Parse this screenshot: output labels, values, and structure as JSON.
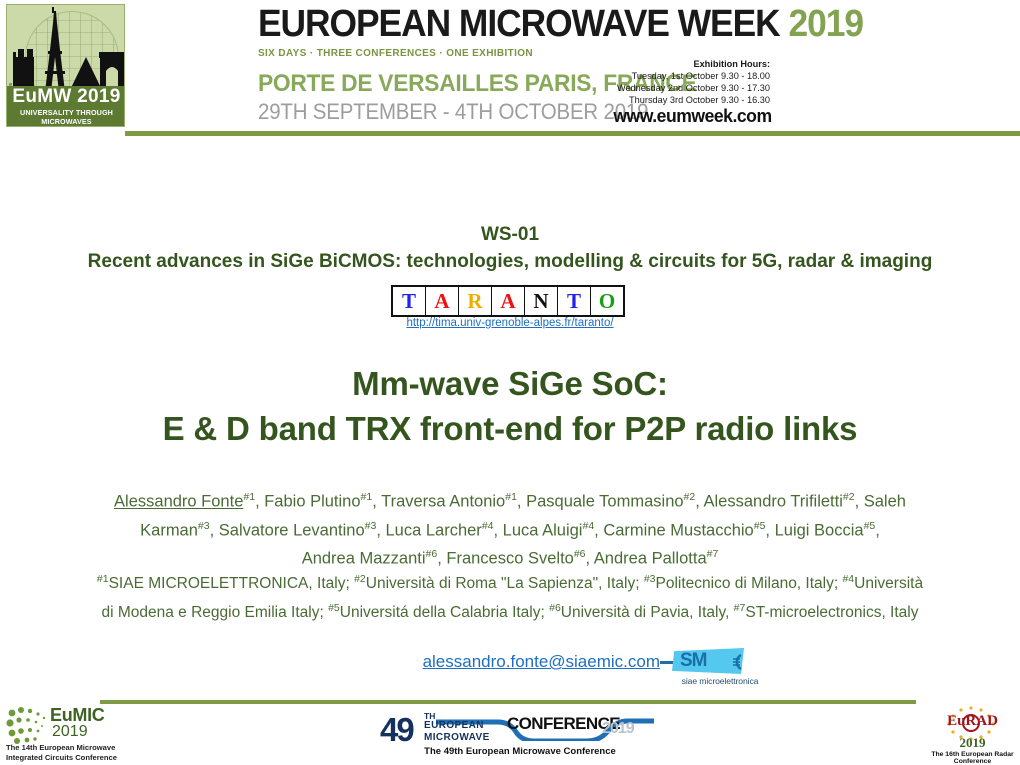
{
  "header": {
    "eumw_logo": {
      "title": "EuMW 2019",
      "tagline": "UNIVERSALITY THROUGH MICROWAVES"
    },
    "banner_title_main": "EUROPEAN MICROWAVE WEEK ",
    "banner_title_year": "2019",
    "banner_subtitle": "SIX DAYS · THREE CONFERENCES · ONE EXHIBITION",
    "banner_venue": "PORTE DE VERSAILLES PARIS, FRANCE",
    "banner_dates": "29TH SEPTEMBER - 4TH OCTOBER 2019",
    "exhibition_hours": {
      "heading": "Exhibition Hours:",
      "lines": [
        "Tuesday, 1st October 9.30 - 18.00",
        "Wednesday 2nd October 9.30 - 17.30",
        "Thursday 3rd October 9.30 - 16.30"
      ]
    },
    "website": "www.eumweek.com"
  },
  "workshop": {
    "code": "WS-01",
    "title": "Recent advances in SiGe BiCMOS: technologies, modelling & circuits for 5G, radar & imaging"
  },
  "taranto": {
    "letters": [
      {
        "char": "T",
        "color": "#2222ee"
      },
      {
        "char": "A",
        "color": "#ee1111"
      },
      {
        "char": "R",
        "color": "#f0ac00"
      },
      {
        "char": "A",
        "color": "#ee1111"
      },
      {
        "char": "N",
        "color": "#111111"
      },
      {
        "char": "T",
        "color": "#2222ee"
      },
      {
        "char": "O",
        "color": "#14a014"
      }
    ],
    "url": "http://tima.univ-grenoble-alpes.fr/taranto/"
  },
  "presentation": {
    "title_line1": "Mm-wave SiGe SoC:",
    "title_line2": "E & D band TRX front-end for P2P radio links",
    "authors_html": "<span class=\"lead\">Alessandro Fonte</span><sup>#1</sup>, Fabio Plutino<sup>#1</sup>, Traversa Antonio<sup>#1</sup>, Pasquale Tommasino<sup>#2</sup>, Alessandro Trifiletti<sup>#2</sup>, Saleh Karman<sup>#3</sup>, Salvatore Levantino<sup>#3</sup>,  Luca Larcher<sup>#4</sup>, Luca Aluigi<sup>#4</sup>, Carmine Mustacchio<sup>#5</sup>, Luigi Boccia<sup>#5</sup>, Andrea Mazzanti<sup>#6</sup>, Francesco Svelto<sup>#6</sup>, Andrea Pallotta<sup>#7</sup>",
    "authors_plain": "Alessandro Fonte#1, Fabio Plutino#1, Traversa Antonio#1, Pasquale Tommasino#2, Alessandro Trifiletti#2, Saleh Karman#3, Salvatore Levantino#3, Luca Larcher#4, Luca Aluigi#4, Carmine Mustacchio#5, Luigi Boccia#5, Andrea Mazzanti#6, Francesco Svelto#6, Andrea Pallotta#7",
    "affiliations_html": "<sup>#1</sup>SIAE MICROELETTRONICA, Italy; <sup>#2</sup>Università di Roma \"La Sapienza\", Italy; <sup>#3</sup>Politecnico di Milano, Italy; <sup>#4</sup>Università di Modena e Reggio Emilia  Italy; <sup>#5</sup>Universitá della Calabria  Italy; <sup>#6</sup>Università di Pavia, Italy, <sup>#7</sup>ST-microelectronics, Italy",
    "affiliations_plain": "#1SIAE MICROELETTRONICA, Italy; #2Università di Roma \"La Sapienza\", Italy; #3Politecnico di Milano, Italy; #4Università di Modena e Reggio Emilia Italy; #5Universitá della Calabria Italy; #6Università di Pavia, Italy, #7ST-microelectronics, Italy",
    "email": "alessandro.fonte@siaemic.com"
  },
  "siae_logo": {
    "mark": "SM",
    "caption": "siae microelettronica"
  },
  "footer": {
    "eumic": {
      "name": "EuMIC",
      "year": "2019",
      "caption": "The 14th European Microwave Integrated Circuits Conference"
    },
    "eumc": {
      "number": "49",
      "ordinal": "TH",
      "line1": "EUROPEAN",
      "line2": "MICROWAVE",
      "conference": "CONFERENCE",
      "year": "2019",
      "caption": "The 49th European Microwave Conference"
    },
    "eurad": {
      "name_prefix": "Eu",
      "name_suffix": "RAD",
      "year": "2019",
      "caption": "The 16th European Radar Conference"
    }
  },
  "colors": {
    "rule_green": "#7e9a45",
    "title_green": "#35551e",
    "author_green": "#4a6b34",
    "link_blue": "#1e6fc4",
    "logo_bg": "#ccd9a8"
  }
}
